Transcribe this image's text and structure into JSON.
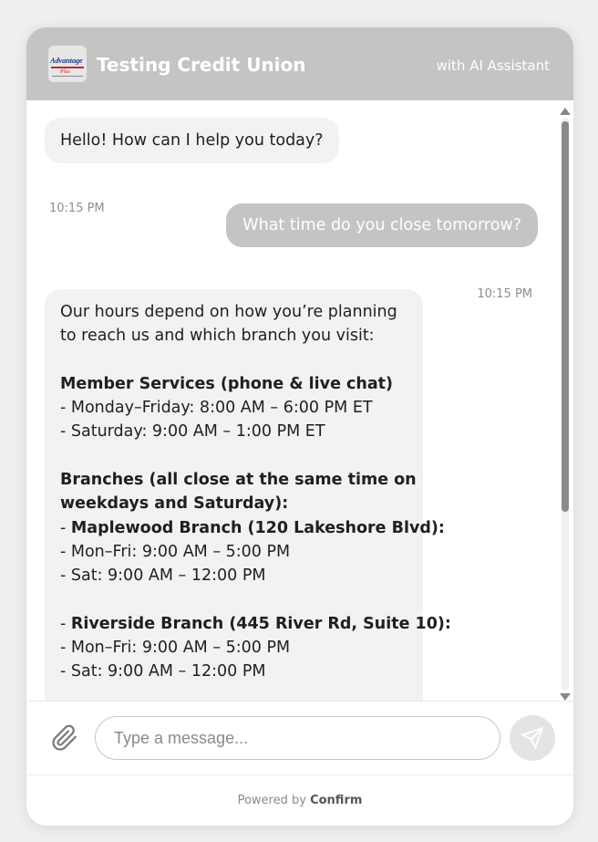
{
  "header": {
    "logo_text": "Advantage",
    "logo_tag": "Plus",
    "title": "Testing Credit Union",
    "subtitle": "with AI Assistant",
    "color": "#c4c4c4"
  },
  "messages": [
    {
      "from": "bot",
      "text": "Hello! How can I help you today?",
      "time": "10:15 PM"
    },
    {
      "from": "user",
      "text": "What time do you close tomorrow?",
      "time": "10:15 PM"
    },
    {
      "from": "bot",
      "lines": [
        {
          "text": "Our hours depend on how you’re planning",
          "bold": false
        },
        {
          "text": "to reach us and which branch you visit:",
          "bold": false
        },
        {
          "text": "",
          "bold": false
        },
        {
          "text": "Member Services (phone & live chat)",
          "bold": true
        },
        {
          "text": "- Monday–Friday: 8:00 AM – 6:00 PM ET",
          "bold": false
        },
        {
          "text": "- Saturday: 9:00 AM – 1:00 PM ET",
          "bold": false
        },
        {
          "text": "",
          "bold": false
        },
        {
          "text": "Branches (all close at the same time on",
          "bold": true
        },
        {
          "text": "weekdays and Saturday):",
          "bold": true
        },
        {
          "prefix": "- ",
          "text": "Maplewood Branch (120 Lakeshore Blvd):",
          "bold": true
        },
        {
          "text": "- Mon–Fri: 9:00 AM – 5:00 PM",
          "bold": false
        },
        {
          "text": "- Sat: 9:00 AM – 12:00 PM",
          "bold": false
        },
        {
          "text": "",
          "bold": false
        },
        {
          "prefix": "- ",
          "text": "Riverside Branch (445 River Rd, Suite 10):",
          "bold": true
        },
        {
          "text": "- Mon–Fri: 9:00 AM – 5:00 PM",
          "bold": false
        },
        {
          "text": "- Sat: 9:00 AM – 12:00 PM",
          "bold": false
        }
      ]
    }
  ],
  "composer": {
    "placeholder": "Type a message...",
    "attach_icon": "paperclip-icon",
    "send_icon": "send-icon"
  },
  "footer": {
    "powered_by": "Powered by",
    "brand": "Confirm"
  }
}
